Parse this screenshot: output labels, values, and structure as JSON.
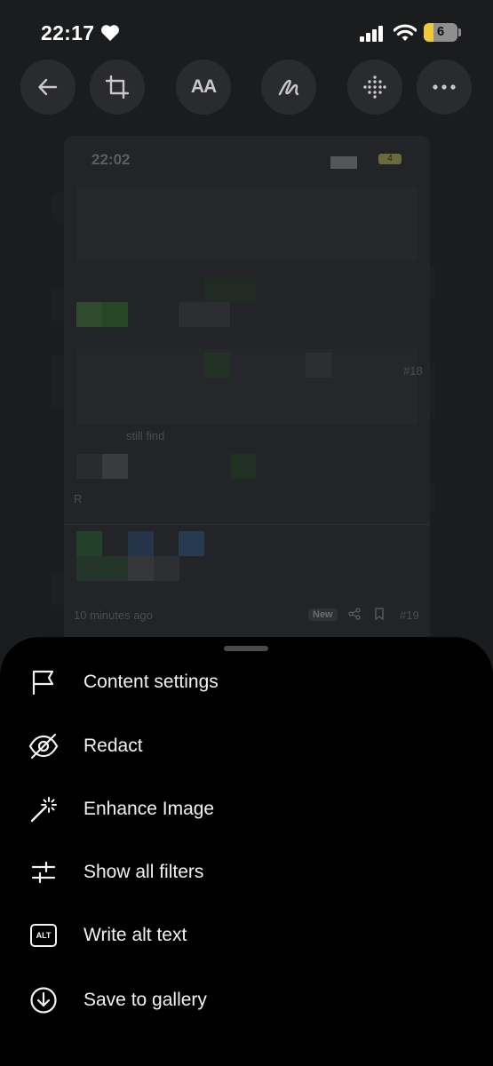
{
  "status_bar": {
    "time": "22:17",
    "battery_level": "6",
    "icons": [
      "heart-icon",
      "signal-icon",
      "wifi-icon",
      "battery-icon"
    ]
  },
  "toolbar": {
    "buttons": [
      "back-arrow-icon",
      "crop-icon",
      "text-size-icon",
      "draw-icon",
      "dots-grid-icon",
      "more-icon"
    ],
    "text_size_glyph": "AA"
  },
  "preview": {
    "time": "22:02",
    "battery": "4",
    "fragments": [
      "#18",
      "still find",
      "R",
      "10 minutes ago",
      "New",
      "#19"
    ]
  },
  "sheet": {
    "items": [
      {
        "label": "Content settings",
        "icon": "flag-icon"
      },
      {
        "label": "Redact",
        "icon": "eye-off-icon"
      },
      {
        "label": "Enhance Image",
        "icon": "magic-wand-icon"
      },
      {
        "label": "Show all filters",
        "icon": "sliders-icon"
      },
      {
        "label": "Write alt text",
        "icon": "alt-text-icon"
      },
      {
        "label": "Save to gallery",
        "icon": "download-circle-icon"
      }
    ],
    "alt_badge": "ALT"
  },
  "colors": {
    "background": "#1b1c1e",
    "sheet": "#000000",
    "tool_button": "#2a2b2e",
    "battery_fill": "#f0c93a"
  }
}
